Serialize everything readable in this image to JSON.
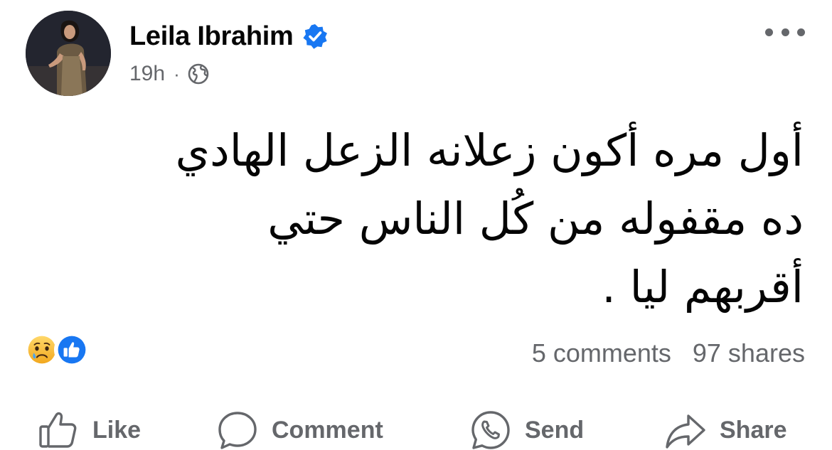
{
  "post": {
    "author_name": "Leila Ibrahim",
    "time": "19h",
    "separator": "·",
    "text_lines": [
      "أول مره أكون زعلانه الزعل الهادي",
      "ده مقفوله من كُل الناس حتي",
      "أقربهم ليا ."
    ]
  },
  "engagement": {
    "reactions": [
      "sad-reaction-icon",
      "like-reaction-icon"
    ],
    "comments": "5 comments",
    "shares": "97 shares"
  },
  "actions": {
    "like": "Like",
    "comment": "Comment",
    "send": "Send",
    "share": "Share"
  },
  "colors": {
    "text": "#050505",
    "secondary": "#65676b",
    "brand_blue": "#1877f2",
    "reaction_yellow": "#f7b125"
  }
}
